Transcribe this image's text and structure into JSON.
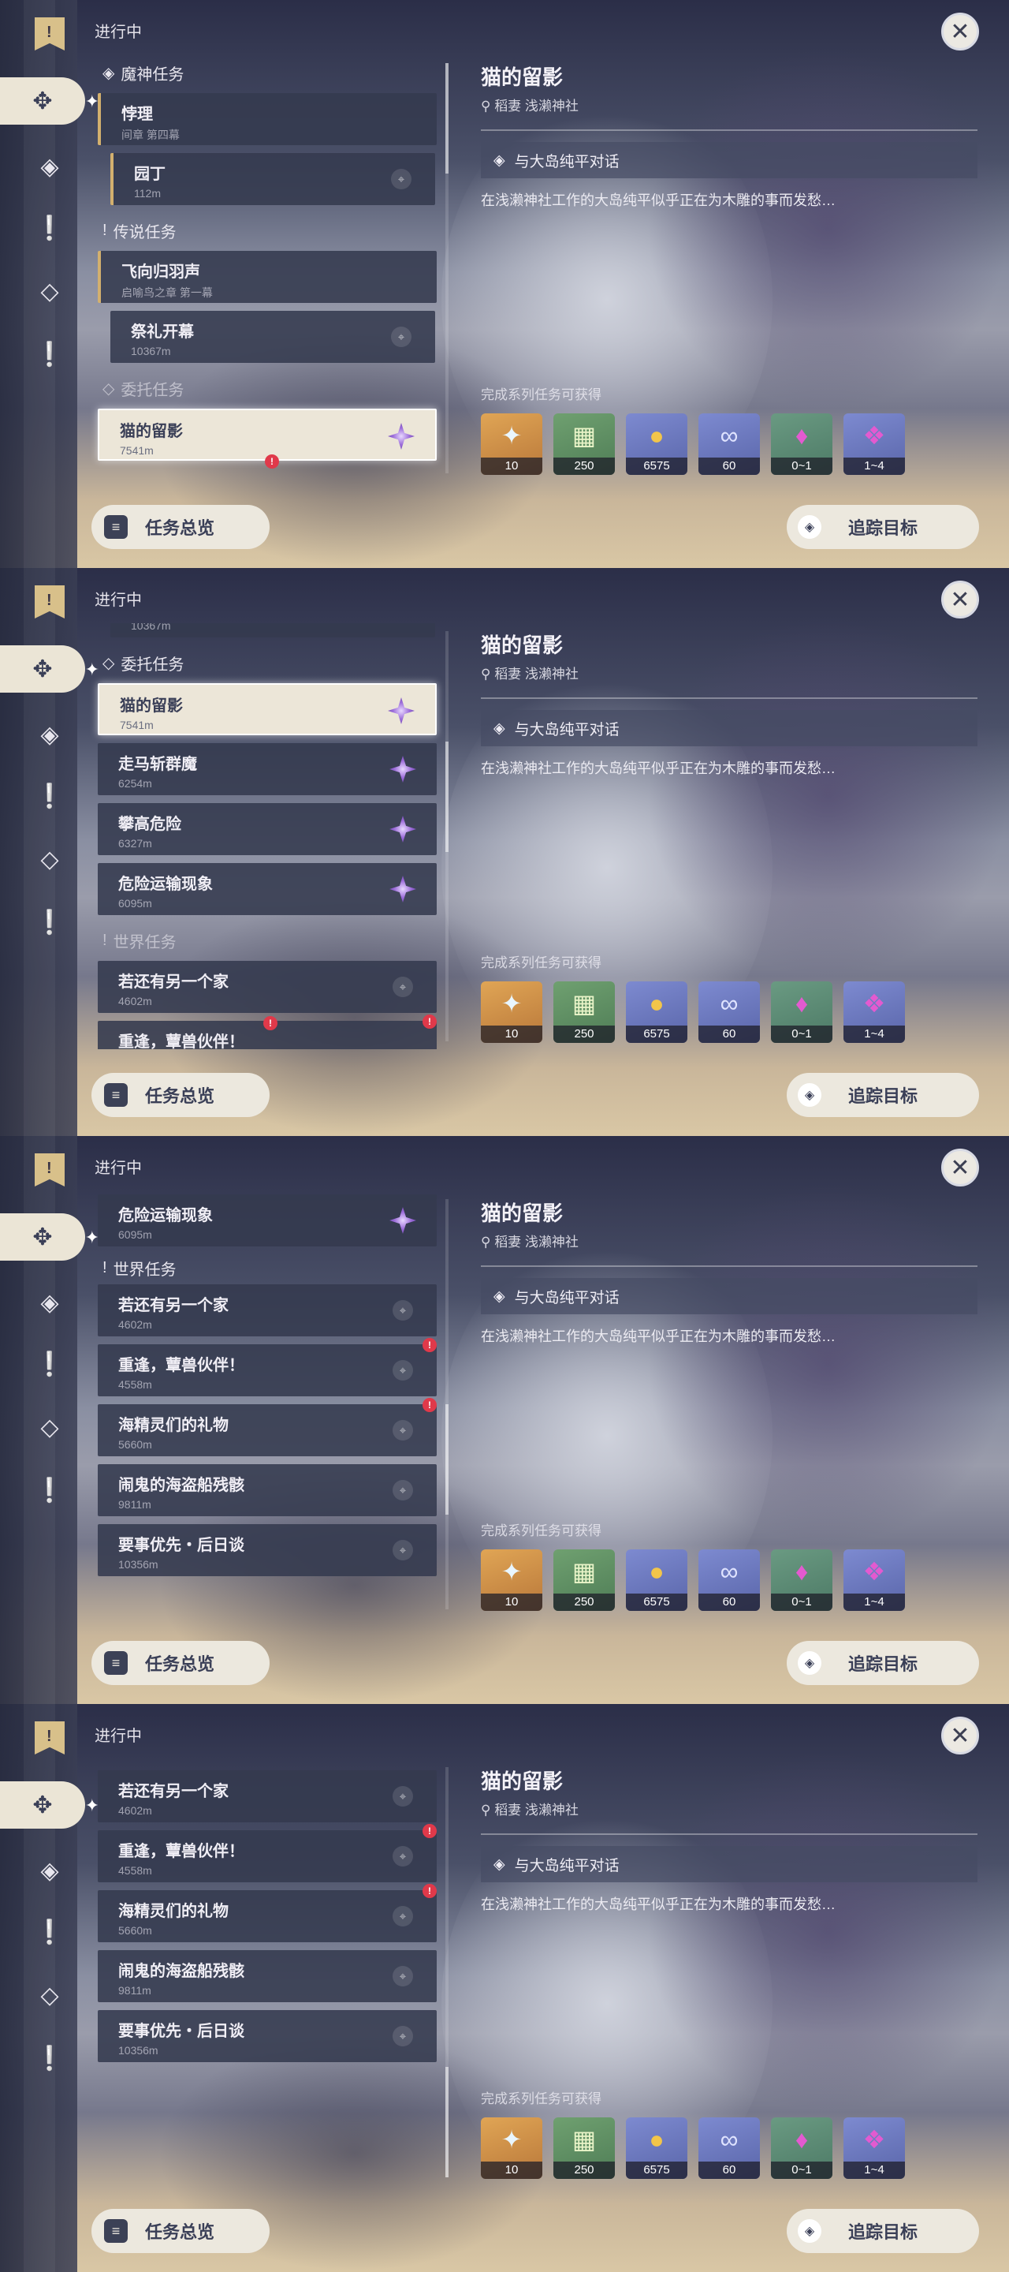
{
  "header": {
    "status": "进行中",
    "bookmark_glyph": "!"
  },
  "detail": {
    "title": "猫的留影",
    "location": "稻妻 浅濑神社",
    "objective": "与大岛纯平对话",
    "description": "在浅濑神社工作的大岛纯平似乎正在为木雕的事而发愁…",
    "rewards_label": "完成系列任务可获得",
    "rewards": [
      {
        "icon": "primogem-icon",
        "count": "10"
      },
      {
        "icon": "adventure-exp-icon",
        "count": "250"
      },
      {
        "icon": "mora-icon",
        "count": "6575"
      },
      {
        "icon": "companionship-exp-icon",
        "count": "60"
      },
      {
        "icon": "crystal-shard-icon",
        "count": "0~1"
      },
      {
        "icon": "crystal-cluster-icon",
        "count": "1~4"
      }
    ]
  },
  "buttons": {
    "overview": "任务总览",
    "track": "追踪目标"
  },
  "sections": {
    "archon": "魔神任务",
    "legend": "传说任务",
    "commission": "委托任务",
    "world": "世界任务"
  },
  "quests": {
    "chapter_q": {
      "title": "悖理",
      "sub": "间章 第四幕"
    },
    "gardener": {
      "title": "园丁",
      "dist": "112m"
    },
    "legend_q": {
      "title": "飞向归羽声",
      "sub": "启喻鸟之章 第一幕"
    },
    "festival": {
      "title": "祭礼开幕",
      "dist": "10367m"
    },
    "cat": {
      "title": "猫的留影",
      "dist": "7541m"
    },
    "horse": {
      "title": "走马斩群魔",
      "dist": "6254m"
    },
    "climb": {
      "title": "攀高危险",
      "dist": "6327m"
    },
    "transport": {
      "title": "危险运输现象",
      "dist": "6095m"
    },
    "home": {
      "title": "若还有另一个家",
      "dist": "4602m"
    },
    "beast": {
      "title": "重逢，蕈兽伙伴！",
      "dist": "4558m"
    },
    "spirits": {
      "title": "海精灵们的礼物",
      "dist": "5660m"
    },
    "pirate": {
      "title": "闹鬼的海盗船残骸",
      "dist": "9811m"
    },
    "later": {
      "title": "要事优先・后日谈",
      "dist": "10356m"
    }
  }
}
